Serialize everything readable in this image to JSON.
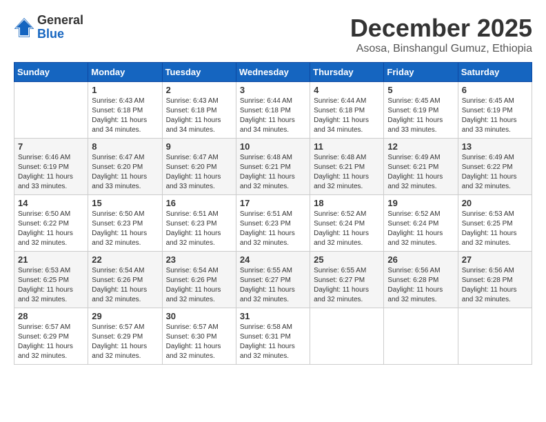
{
  "logo": {
    "general": "General",
    "blue": "Blue"
  },
  "title": {
    "month_year": "December 2025",
    "location": "Asosa, Binshangul Gumuz, Ethiopia"
  },
  "weekdays": [
    "Sunday",
    "Monday",
    "Tuesday",
    "Wednesday",
    "Thursday",
    "Friday",
    "Saturday"
  ],
  "weeks": [
    [
      {
        "day": "",
        "info": ""
      },
      {
        "day": "1",
        "info": "Sunrise: 6:43 AM\nSunset: 6:18 PM\nDaylight: 11 hours\nand 34 minutes."
      },
      {
        "day": "2",
        "info": "Sunrise: 6:43 AM\nSunset: 6:18 PM\nDaylight: 11 hours\nand 34 minutes."
      },
      {
        "day": "3",
        "info": "Sunrise: 6:44 AM\nSunset: 6:18 PM\nDaylight: 11 hours\nand 34 minutes."
      },
      {
        "day": "4",
        "info": "Sunrise: 6:44 AM\nSunset: 6:18 PM\nDaylight: 11 hours\nand 34 minutes."
      },
      {
        "day": "5",
        "info": "Sunrise: 6:45 AM\nSunset: 6:19 PM\nDaylight: 11 hours\nand 33 minutes."
      },
      {
        "day": "6",
        "info": "Sunrise: 6:45 AM\nSunset: 6:19 PM\nDaylight: 11 hours\nand 33 minutes."
      }
    ],
    [
      {
        "day": "7",
        "info": "Sunrise: 6:46 AM\nSunset: 6:19 PM\nDaylight: 11 hours\nand 33 minutes."
      },
      {
        "day": "8",
        "info": "Sunrise: 6:47 AM\nSunset: 6:20 PM\nDaylight: 11 hours\nand 33 minutes."
      },
      {
        "day": "9",
        "info": "Sunrise: 6:47 AM\nSunset: 6:20 PM\nDaylight: 11 hours\nand 33 minutes."
      },
      {
        "day": "10",
        "info": "Sunrise: 6:48 AM\nSunset: 6:21 PM\nDaylight: 11 hours\nand 32 minutes."
      },
      {
        "day": "11",
        "info": "Sunrise: 6:48 AM\nSunset: 6:21 PM\nDaylight: 11 hours\nand 32 minutes."
      },
      {
        "day": "12",
        "info": "Sunrise: 6:49 AM\nSunset: 6:21 PM\nDaylight: 11 hours\nand 32 minutes."
      },
      {
        "day": "13",
        "info": "Sunrise: 6:49 AM\nSunset: 6:22 PM\nDaylight: 11 hours\nand 32 minutes."
      }
    ],
    [
      {
        "day": "14",
        "info": "Sunrise: 6:50 AM\nSunset: 6:22 PM\nDaylight: 11 hours\nand 32 minutes."
      },
      {
        "day": "15",
        "info": "Sunrise: 6:50 AM\nSunset: 6:23 PM\nDaylight: 11 hours\nand 32 minutes."
      },
      {
        "day": "16",
        "info": "Sunrise: 6:51 AM\nSunset: 6:23 PM\nDaylight: 11 hours\nand 32 minutes."
      },
      {
        "day": "17",
        "info": "Sunrise: 6:51 AM\nSunset: 6:23 PM\nDaylight: 11 hours\nand 32 minutes."
      },
      {
        "day": "18",
        "info": "Sunrise: 6:52 AM\nSunset: 6:24 PM\nDaylight: 11 hours\nand 32 minutes."
      },
      {
        "day": "19",
        "info": "Sunrise: 6:52 AM\nSunset: 6:24 PM\nDaylight: 11 hours\nand 32 minutes."
      },
      {
        "day": "20",
        "info": "Sunrise: 6:53 AM\nSunset: 6:25 PM\nDaylight: 11 hours\nand 32 minutes."
      }
    ],
    [
      {
        "day": "21",
        "info": "Sunrise: 6:53 AM\nSunset: 6:25 PM\nDaylight: 11 hours\nand 32 minutes."
      },
      {
        "day": "22",
        "info": "Sunrise: 6:54 AM\nSunset: 6:26 PM\nDaylight: 11 hours\nand 32 minutes."
      },
      {
        "day": "23",
        "info": "Sunrise: 6:54 AM\nSunset: 6:26 PM\nDaylight: 11 hours\nand 32 minutes."
      },
      {
        "day": "24",
        "info": "Sunrise: 6:55 AM\nSunset: 6:27 PM\nDaylight: 11 hours\nand 32 minutes."
      },
      {
        "day": "25",
        "info": "Sunrise: 6:55 AM\nSunset: 6:27 PM\nDaylight: 11 hours\nand 32 minutes."
      },
      {
        "day": "26",
        "info": "Sunrise: 6:56 AM\nSunset: 6:28 PM\nDaylight: 11 hours\nand 32 minutes."
      },
      {
        "day": "27",
        "info": "Sunrise: 6:56 AM\nSunset: 6:28 PM\nDaylight: 11 hours\nand 32 minutes."
      }
    ],
    [
      {
        "day": "28",
        "info": "Sunrise: 6:57 AM\nSunset: 6:29 PM\nDaylight: 11 hours\nand 32 minutes."
      },
      {
        "day": "29",
        "info": "Sunrise: 6:57 AM\nSunset: 6:29 PM\nDaylight: 11 hours\nand 32 minutes."
      },
      {
        "day": "30",
        "info": "Sunrise: 6:57 AM\nSunset: 6:30 PM\nDaylight: 11 hours\nand 32 minutes."
      },
      {
        "day": "31",
        "info": "Sunrise: 6:58 AM\nSunset: 6:31 PM\nDaylight: 11 hours\nand 32 minutes."
      },
      {
        "day": "",
        "info": ""
      },
      {
        "day": "",
        "info": ""
      },
      {
        "day": "",
        "info": ""
      }
    ]
  ]
}
